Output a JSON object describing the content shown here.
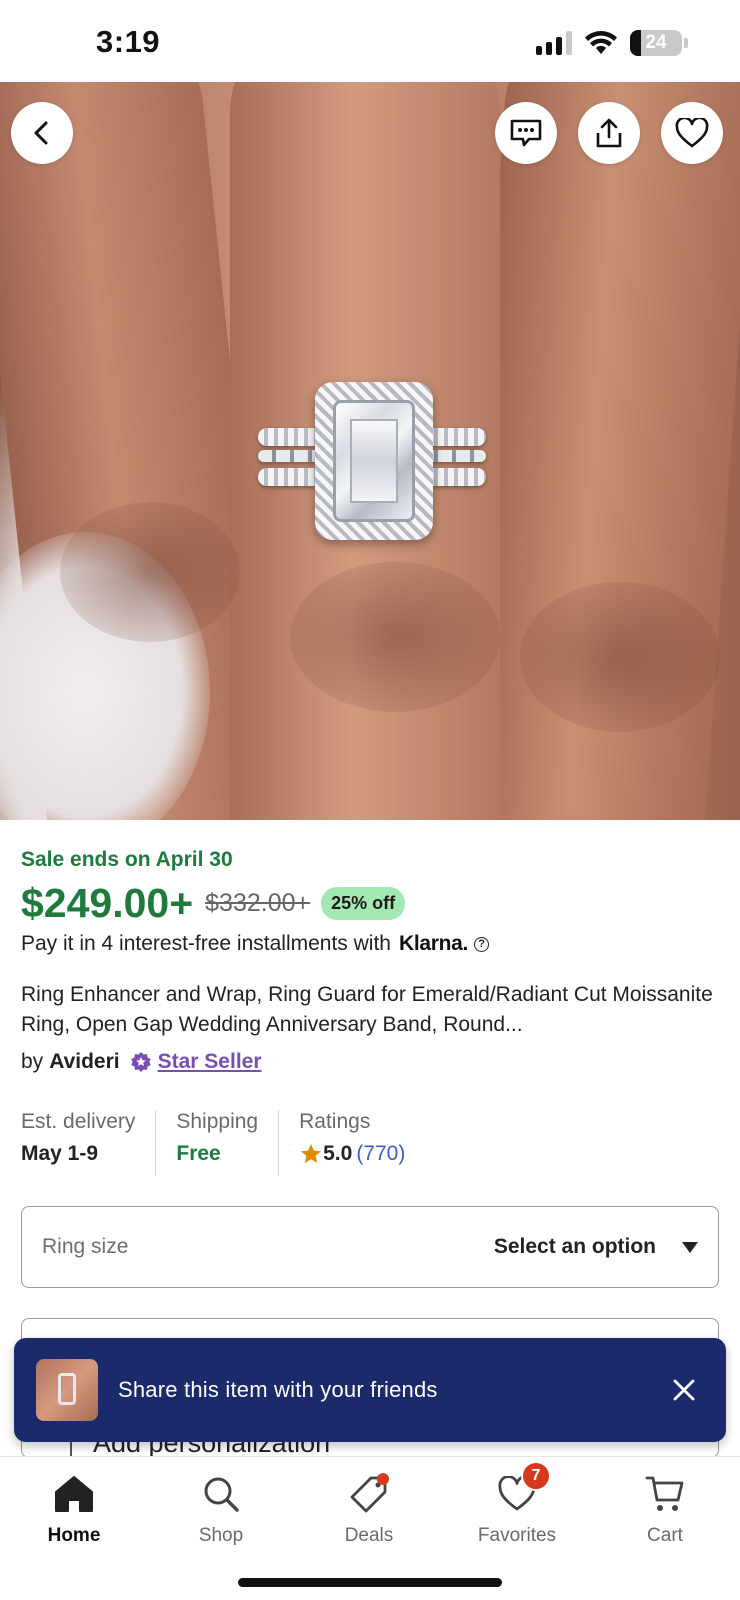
{
  "status_bar": {
    "time": "3:19",
    "battery": "24"
  },
  "product": {
    "sale_ends": "Sale ends on April 30",
    "price": "$249.00+",
    "original_price": "$332.00+",
    "discount": "25% off",
    "installments": "Pay it in 4 interest-free installments with",
    "klarna": "Klarna.",
    "title": "Ring Enhancer and Wrap, Ring Guard for Emerald/Radiant Cut Moissanite Ring, Open Gap Wedding Anniversary Band, Round...",
    "by_label": "by",
    "seller": "Avideri",
    "seller_badge": "Star Seller"
  },
  "info": {
    "delivery_label": "Est. delivery",
    "delivery_value": "May 1-9",
    "shipping_label": "Shipping",
    "shipping_value": "Free",
    "ratings_label": "Ratings",
    "rating_value": "5.0",
    "rating_count": "(770)"
  },
  "options": {
    "ring_size_label": "Ring size",
    "ring_size_value": "Select an option",
    "personalization_label": "Add personalization"
  },
  "toast": {
    "text": "Share this item with your friends"
  },
  "nav": {
    "items": [
      {
        "label": "Home",
        "icon": "home-icon",
        "active": true
      },
      {
        "label": "Shop",
        "icon": "search-icon"
      },
      {
        "label": "Deals",
        "icon": "tag-icon"
      },
      {
        "label": "Favorites",
        "icon": "heart-icon",
        "badge": "7"
      },
      {
        "label": "Cart",
        "icon": "cart-icon"
      }
    ]
  },
  "colors": {
    "sale_green": "#1f7a3e",
    "discount_bg": "#a3e8b0",
    "toast_bg": "#1a2a6b",
    "star_seller": "#7a4fb3",
    "badge_red": "#d6391f",
    "rating_link": "#3b5fc4"
  }
}
